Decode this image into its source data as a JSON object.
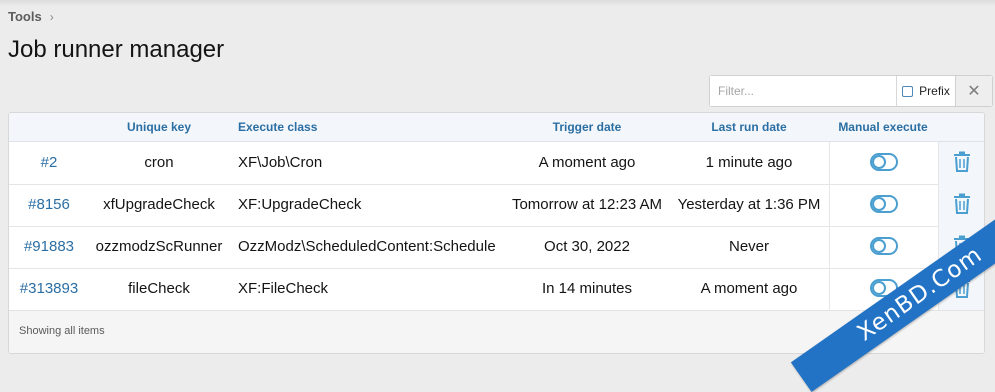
{
  "breadcrumb": {
    "items": [
      "Tools"
    ]
  },
  "page": {
    "title": "Job runner manager"
  },
  "filter": {
    "placeholder": "Filter...",
    "prefix_label": "Prefix",
    "clear_glyph": "✕"
  },
  "table": {
    "headers": [
      "",
      "Unique key",
      "Execute class",
      "Trigger date",
      "Last run date",
      "Manual execute"
    ],
    "rows": [
      {
        "id": "#2",
        "key": "cron",
        "class": "XF\\Job\\Cron",
        "trigger": "A moment ago",
        "last_run": "1 minute ago"
      },
      {
        "id": "#8156",
        "key": "xfUpgradeCheck",
        "class": "XF:UpgradeCheck",
        "trigger": "Tomorrow at 12:23 AM",
        "last_run": "Yesterday at 1:36 PM"
      },
      {
        "id": "#91883",
        "key": "ozzmodzScRunner",
        "class": "OzzModz\\ScheduledContent:Schedule",
        "trigger": "Oct 30, 2022",
        "last_run": "Never"
      },
      {
        "id": "#313893",
        "key": "fileCheck",
        "class": "XF:FileCheck",
        "trigger": "In 14 minutes",
        "last_run": "A moment ago"
      }
    ],
    "row_icons": {
      "manual_execute": "toggle-icon",
      "delete": "trash-icon"
    },
    "footer": "Showing all items"
  },
  "watermark": {
    "text": "XenBD.Com"
  },
  "colors": {
    "accent": "#2b6ea3",
    "icon": "#4a9fd0",
    "header_bg": "#f3f7fb",
    "watermark": "#2273c5"
  }
}
